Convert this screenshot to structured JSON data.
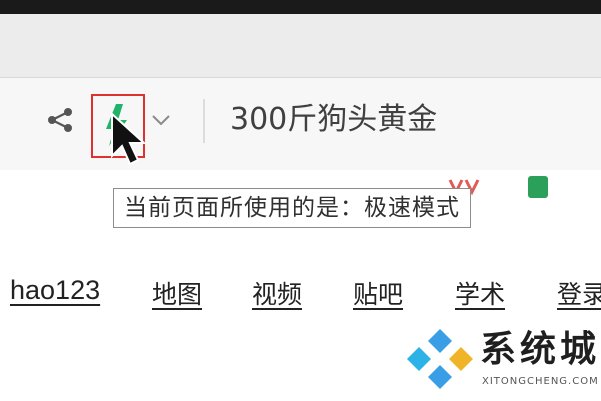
{
  "browser": {
    "toolbar": {
      "share_icon": "share-icon",
      "speed_mode_icon": "lightning-icon",
      "dropdown_icon": "chevron-down-icon",
      "search_text": "300斤狗头黄金"
    },
    "tooltip": "当前页面所使用的是：极速模式"
  },
  "page": {
    "nav_links": [
      "hao123",
      "地图",
      "视频",
      "贴吧",
      "学术",
      "登录"
    ]
  },
  "watermark": {
    "name": "系统城",
    "url": "XITONGCHENG.COM"
  },
  "colors": {
    "highlight_box": "#e03131",
    "speed_icon": "#22b36b"
  }
}
